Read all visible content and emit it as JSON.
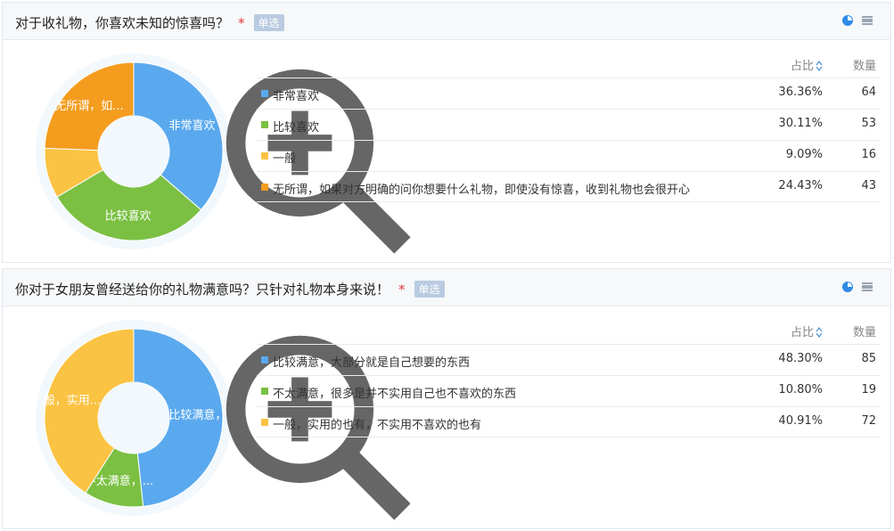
{
  "columns": {
    "percent": "占比",
    "count": "数量"
  },
  "questions": [
    {
      "title": "对于收礼物，你喜欢未知的惊喜吗？",
      "required_mark": "*",
      "type": "单选",
      "options": [
        {
          "label": "非常喜欢",
          "percent": "36.36%",
          "count": "64",
          "color": "#5aa9ee"
        },
        {
          "label": "比较喜欢",
          "percent": "30.11%",
          "count": "53",
          "color": "#7bc043"
        },
        {
          "label": "一般",
          "percent": "9.09%",
          "count": "16",
          "color": "#fbc343"
        },
        {
          "label": "无所谓，如果对方明确的问你想要什么礼物，即使没有惊喜，收到礼物也会很开心",
          "percent": "24.43%",
          "count": "43",
          "color": "#f49c1e"
        }
      ],
      "chart_data": {
        "type": "pie",
        "categories": [
          "非常喜欢",
          "比较喜欢",
          "一般",
          "无所谓，如果对方明确的问你想要什么礼物，即使没有惊喜，收到礼物也会很开心"
        ],
        "values": [
          64,
          53,
          16,
          43
        ],
        "slice_labels": [
          "非常喜欢",
          "比较喜欢",
          "",
          "无所谓，如..."
        ]
      }
    },
    {
      "title": "你对于女朋友曾经送给你的礼物满意吗？只针对礼物本身来说！",
      "required_mark": "*",
      "type": "单选",
      "options": [
        {
          "label": "比较满意，大部分就是自己想要的东西",
          "percent": "48.30%",
          "count": "85",
          "color": "#5aa9ee"
        },
        {
          "label": "不太满意，很多是并不实用自己也不喜欢的东西",
          "percent": "10.80%",
          "count": "19",
          "color": "#7bc043"
        },
        {
          "label": "一般，实用的也有，不实用不喜欢的也有",
          "percent": "40.91%",
          "count": "72",
          "color": "#fbc343"
        }
      ],
      "chart_data": {
        "type": "pie",
        "categories": [
          "比较满意，大部分就是自己想要的东西",
          "不太满意，很多是并不实用自己也不喜欢的东西",
          "一般，实用的也有，不实用不喜欢的也有"
        ],
        "values": [
          85,
          19,
          72
        ],
        "slice_labels": [
          "比较满意，",
          "不太满意，...",
          "般，实用..."
        ]
      }
    }
  ]
}
